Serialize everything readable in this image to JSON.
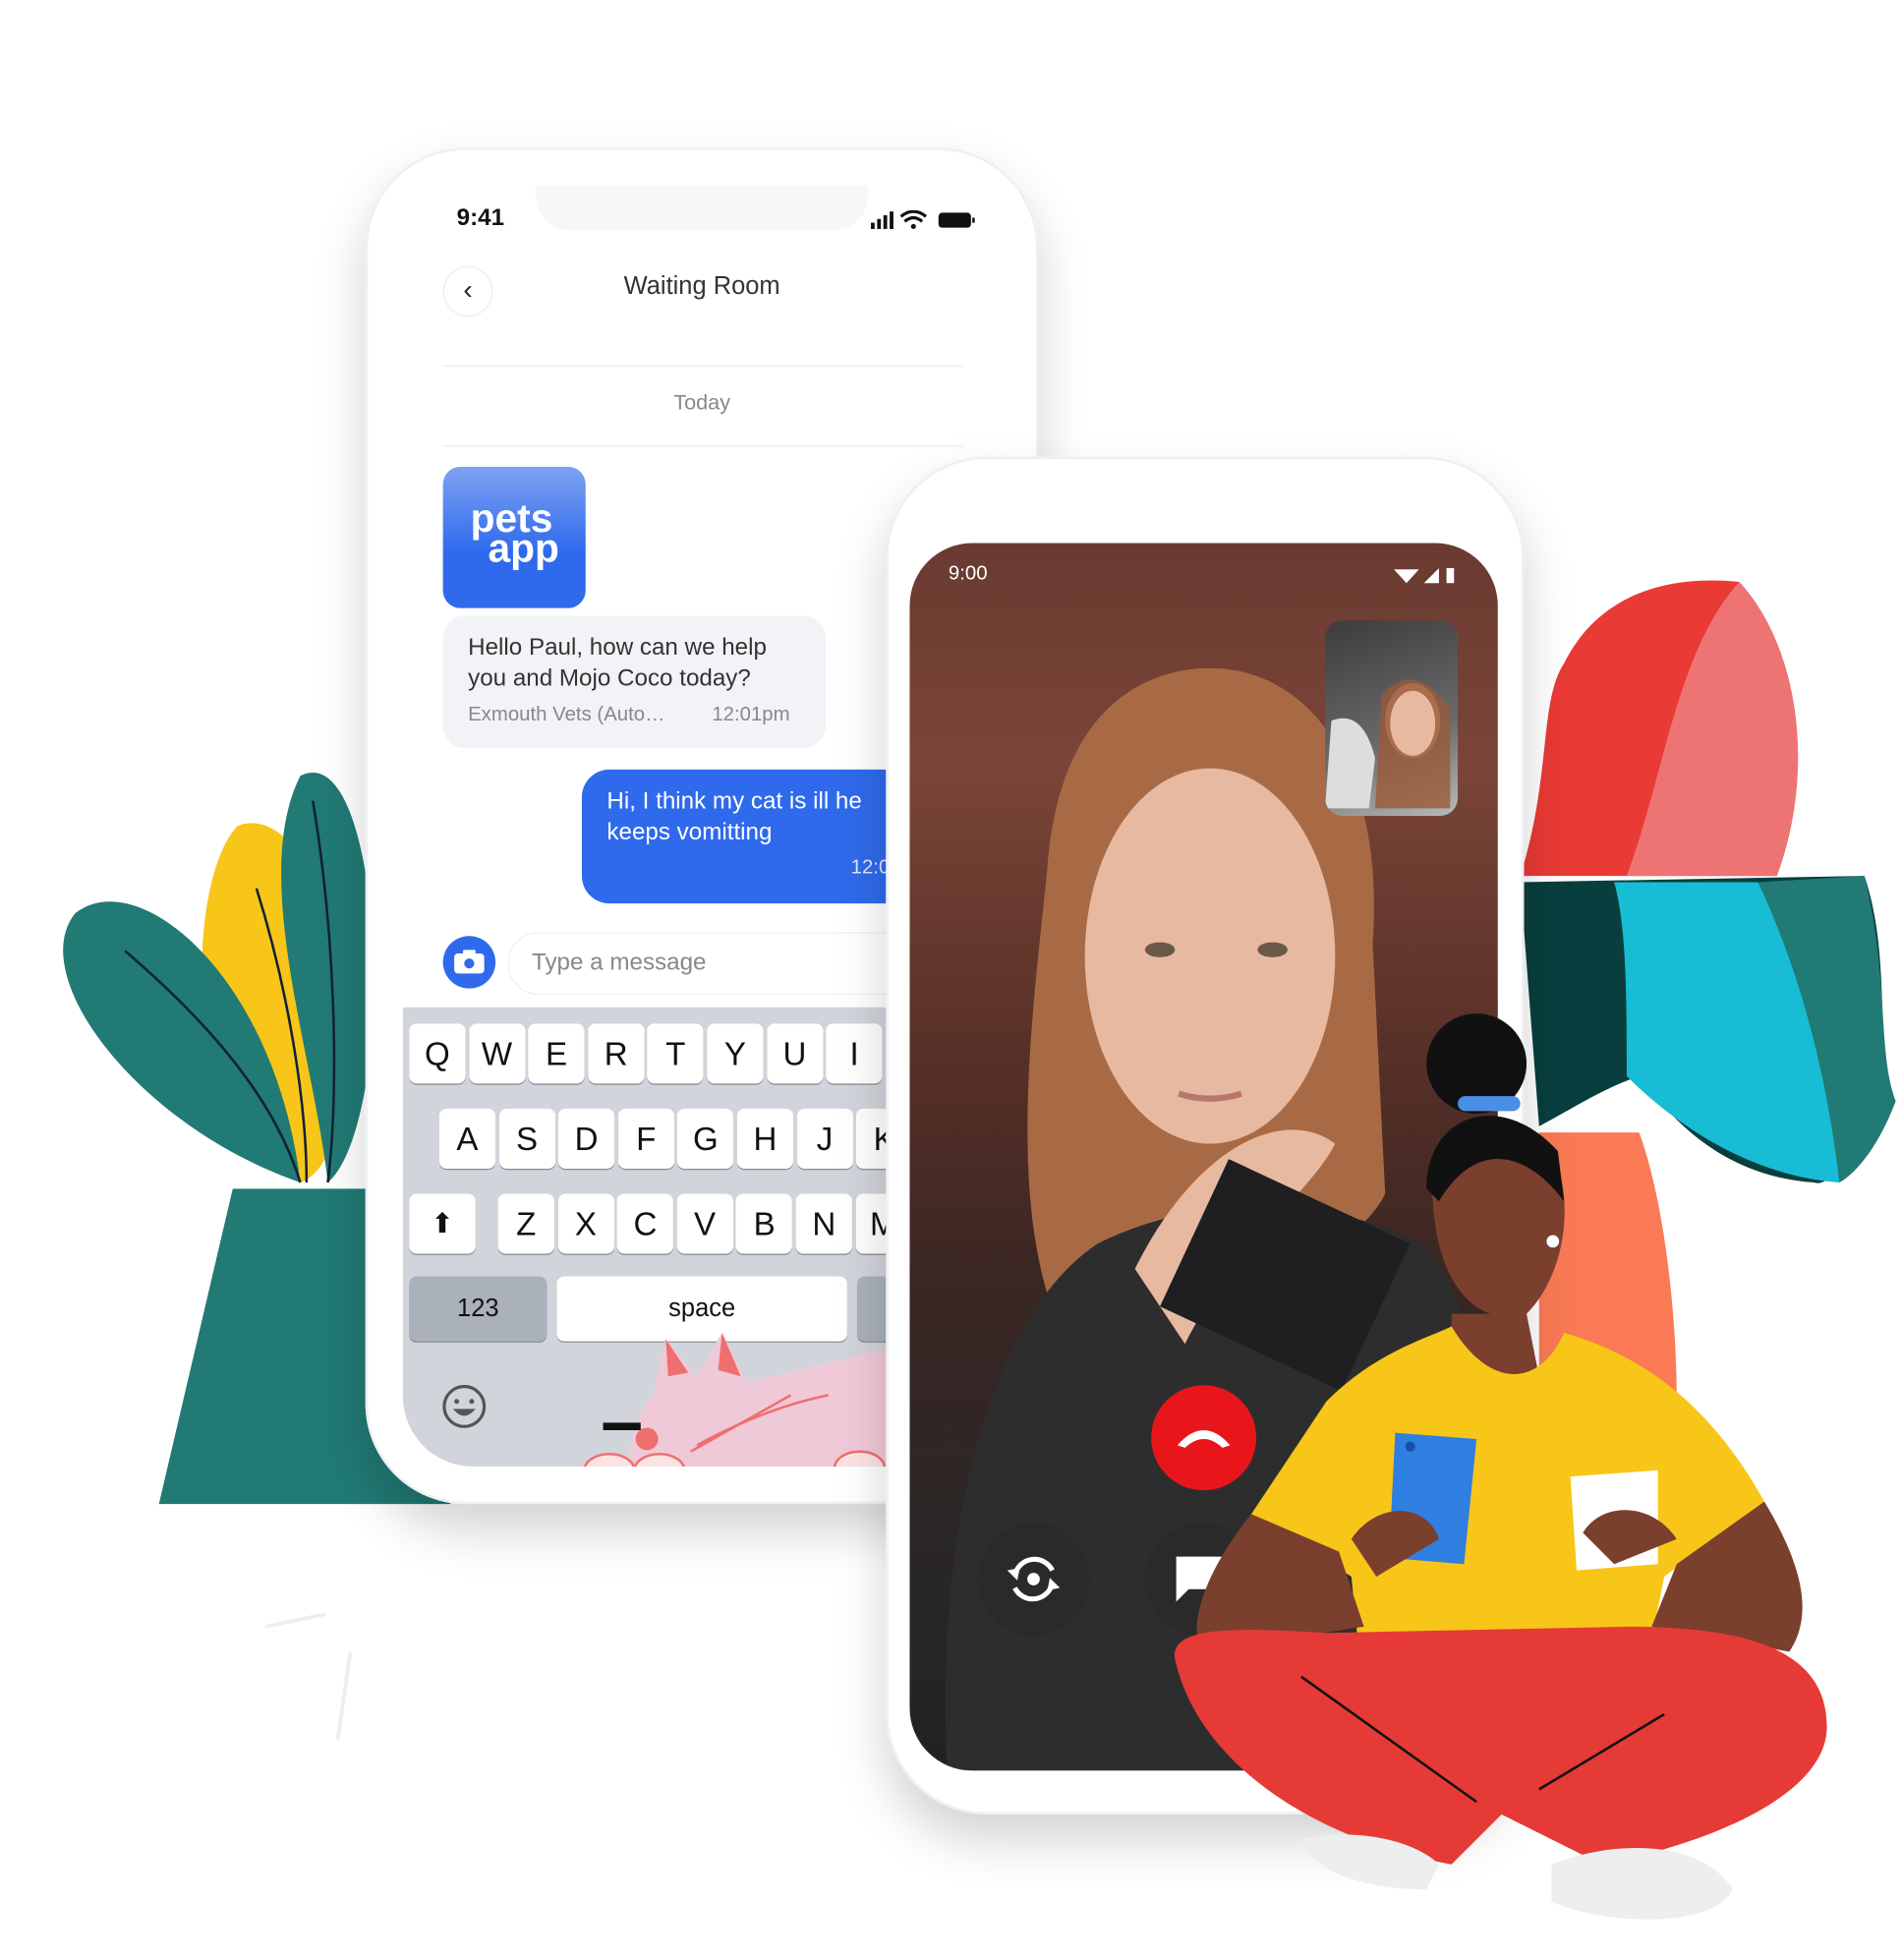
{
  "chat_phone": {
    "status_time": "9:41",
    "header_title": "Waiting Room",
    "date_separator": "Today",
    "logo_text": [
      "pets",
      "app"
    ],
    "messages": [
      {
        "from": "clinic",
        "lines": [
          "Hello Paul, how can we help",
          "you and Mojo Coco today?"
        ],
        "sender": "Exmouth Vets (Auto…",
        "time": "12:01pm"
      },
      {
        "from": "user",
        "lines": [
          "Hi, I think my cat is ill he",
          "keeps vomitting"
        ],
        "time": "12:0"
      }
    ],
    "input_placeholder": "Type a message",
    "keyboard": {
      "rows": [
        [
          "Q",
          "W",
          "E",
          "R",
          "T",
          "Y",
          "U",
          "I"
        ],
        [
          "A",
          "S",
          "D",
          "F",
          "G",
          "H",
          "J",
          "K"
        ],
        [
          "Z",
          "X",
          "C",
          "V",
          "B",
          "N",
          "M"
        ]
      ],
      "numbers_key": "123",
      "space_key": "space"
    }
  },
  "video_phone": {
    "status_time": "9:00",
    "controls": [
      "flip-camera",
      "end-call",
      "chat"
    ]
  },
  "colors": {
    "accent": "#2f6aec",
    "end_call": "#e8161b",
    "teal": "#217a74",
    "yellow": "#f8c519",
    "red": "#e63a36"
  }
}
